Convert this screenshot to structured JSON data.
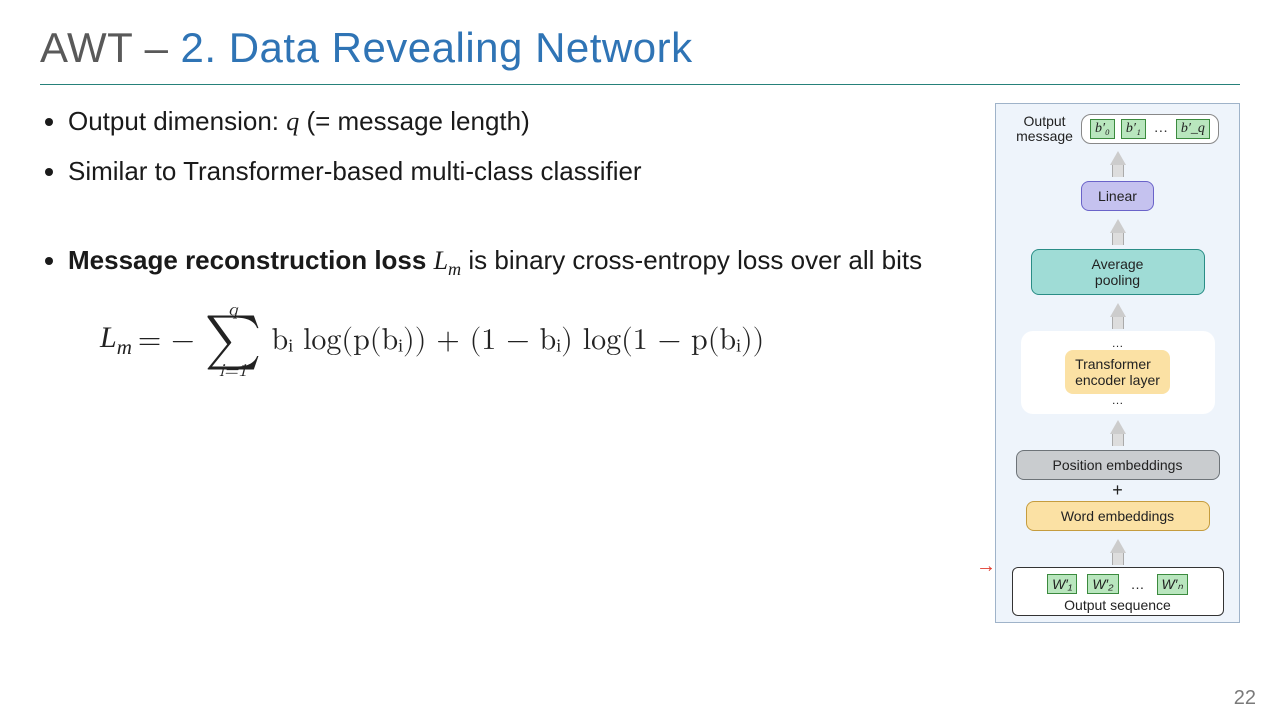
{
  "title": {
    "prefix": "AWT –",
    "main": "2. Data Revealing Network"
  },
  "bullets": {
    "b1_pre": "Output dimension: ",
    "b1_var": "q",
    "b1_post": " (= message length)",
    "b2": "Similar to Transformer-based multi-class classifier",
    "b3_strong": "Message reconstruction loss ",
    "b3_var": "L",
    "b3_sub": "m",
    "b3_post": " is binary cross-entropy loss over all bits"
  },
  "equation": {
    "lhs_L": "L",
    "lhs_sub": "m",
    "eq": " = −",
    "sum_top": "q",
    "sum_sym": "∑",
    "sum_bot": "i=1",
    "rhs": "bᵢ log(p(bᵢ)) + (1 − bᵢ) log(1 − p(bᵢ))"
  },
  "diagram": {
    "out_label_l1": "Output",
    "out_label_l2": "message",
    "b0": "b′₀",
    "b1": "b′₁",
    "bq": "b′_q",
    "dots": "…",
    "linear": "Linear",
    "avgpool_l1": "Average",
    "avgpool_l2": "pooling",
    "enc_l1": "Transformer",
    "enc_l2": "encoder layer",
    "posemb": "Position embeddings",
    "plus": "+",
    "wordemb": "Word embeddings",
    "w1": "W′₁",
    "w2": "W′₂",
    "wn": "W′ₙ",
    "outseq": "Output sequence"
  },
  "slide_number": "22"
}
